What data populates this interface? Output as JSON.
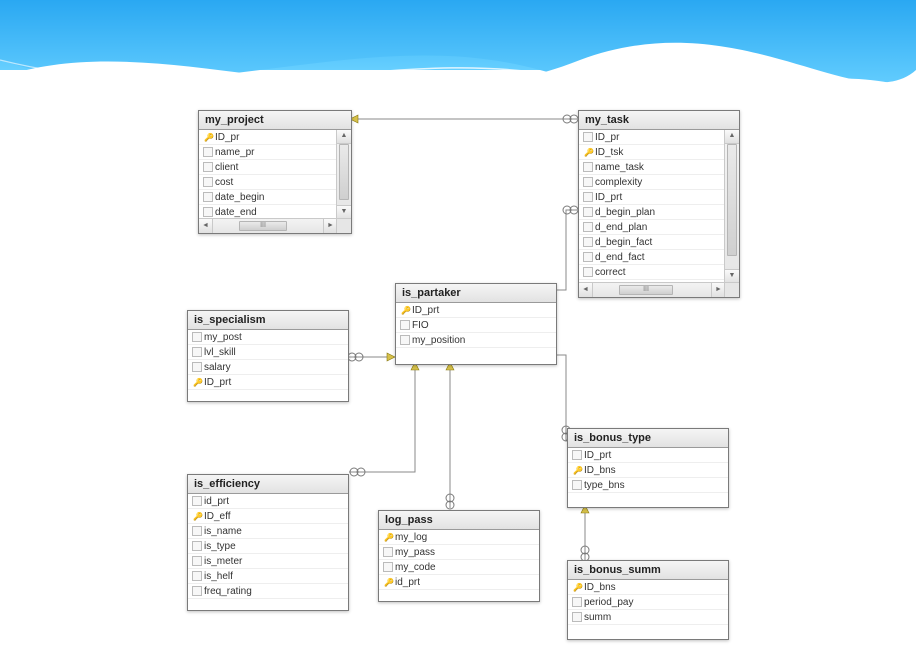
{
  "tables": {
    "my_project": {
      "title": "my_project",
      "columns": [
        {
          "name": "ID_pr",
          "pk": true
        },
        {
          "name": "name_pr",
          "pk": false
        },
        {
          "name": "client",
          "pk": false
        },
        {
          "name": "cost",
          "pk": false
        },
        {
          "name": "date_begin",
          "pk": false
        },
        {
          "name": "date_end",
          "pk": false
        }
      ]
    },
    "my_task": {
      "title": "my_task",
      "columns": [
        {
          "name": "ID_pr",
          "pk": false
        },
        {
          "name": "ID_tsk",
          "pk": true
        },
        {
          "name": "name_task",
          "pk": false
        },
        {
          "name": "complexity",
          "pk": false
        },
        {
          "name": "ID_prt",
          "pk": false
        },
        {
          "name": "d_begin_plan",
          "pk": false
        },
        {
          "name": "d_end_plan",
          "pk": false
        },
        {
          "name": "d_begin_fact",
          "pk": false
        },
        {
          "name": "d_end_fact",
          "pk": false
        },
        {
          "name": "correct",
          "pk": false
        }
      ]
    },
    "is_partaker": {
      "title": "is_partaker",
      "columns": [
        {
          "name": "ID_prt",
          "pk": true
        },
        {
          "name": "FIO",
          "pk": false
        },
        {
          "name": "my_position",
          "pk": false
        }
      ]
    },
    "is_specialism": {
      "title": "is_specialism",
      "columns": [
        {
          "name": "my_post",
          "pk": false
        },
        {
          "name": "lvl_skill",
          "pk": false
        },
        {
          "name": "salary",
          "pk": false
        },
        {
          "name": "ID_prt",
          "pk": true
        }
      ]
    },
    "is_efficiency": {
      "title": "is_efficiency",
      "columns": [
        {
          "name": "id_prt",
          "pk": false
        },
        {
          "name": "ID_eff",
          "pk": true
        },
        {
          "name": "is_name",
          "pk": false
        },
        {
          "name": "is_type",
          "pk": false
        },
        {
          "name": "is_meter",
          "pk": false
        },
        {
          "name": "is_helf",
          "pk": false
        },
        {
          "name": "freq_rating",
          "pk": false
        }
      ]
    },
    "log_pass": {
      "title": "log_pass",
      "columns": [
        {
          "name": "my_log",
          "pk": true
        },
        {
          "name": "my_pass",
          "pk": false
        },
        {
          "name": "my_code",
          "pk": false
        },
        {
          "name": "id_prt",
          "pk": true
        }
      ]
    },
    "is_bonus_type": {
      "title": "is_bonus_type",
      "columns": [
        {
          "name": "ID_prt",
          "pk": false
        },
        {
          "name": "ID_bns",
          "pk": true
        },
        {
          "name": "type_bns",
          "pk": false
        }
      ]
    },
    "is_bonus_summ": {
      "title": "is_bonus_summ",
      "columns": [
        {
          "name": "ID_bns",
          "pk": true
        },
        {
          "name": "period_pay",
          "pk": false
        },
        {
          "name": "summ",
          "pk": false
        }
      ]
    }
  },
  "hscroll_label": "III",
  "scroll_arrows": {
    "up": "▲",
    "down": "▼",
    "left": "◄",
    "right": "►"
  },
  "relationships": [
    {
      "from_table": "my_project",
      "from_col": "ID_pr",
      "from_card": "1",
      "to_table": "my_task",
      "to_col": "ID_pr",
      "to_card": "∞"
    },
    {
      "from_table": "is_partaker",
      "from_col": "ID_prt",
      "from_card": "1",
      "to_table": "my_task",
      "to_col": "ID_prt",
      "to_card": "∞"
    },
    {
      "from_table": "is_partaker",
      "from_col": "ID_prt",
      "from_card": "1",
      "to_table": "is_specialism",
      "to_col": "ID_prt",
      "to_card": "∞"
    },
    {
      "from_table": "is_partaker",
      "from_col": "ID_prt",
      "from_card": "1",
      "to_table": "is_efficiency",
      "to_col": "id_prt",
      "to_card": "∞"
    },
    {
      "from_table": "is_partaker",
      "from_col": "ID_prt",
      "from_card": "1",
      "to_table": "log_pass",
      "to_col": "id_prt",
      "to_card": "∞"
    },
    {
      "from_table": "is_partaker",
      "from_col": "ID_prt",
      "from_card": "1",
      "to_table": "is_bonus_type",
      "to_col": "ID_prt",
      "to_card": "∞"
    },
    {
      "from_table": "is_bonus_type",
      "from_col": "ID_bns",
      "from_card": "1",
      "to_table": "is_bonus_summ",
      "to_col": "ID_bns",
      "to_card": "∞"
    }
  ],
  "chart_data": {
    "type": "table",
    "title": "Entity-Relationship Diagram",
    "entities": [
      "my_project",
      "my_task",
      "is_partaker",
      "is_specialism",
      "is_efficiency",
      "log_pass",
      "is_bonus_type",
      "is_bonus_summ"
    ],
    "relationships": [
      [
        "my_project",
        "1",
        "∞",
        "my_task"
      ],
      [
        "is_partaker",
        "1",
        "∞",
        "my_task"
      ],
      [
        "is_partaker",
        "1",
        "∞",
        "is_specialism"
      ],
      [
        "is_partaker",
        "1",
        "∞",
        "is_efficiency"
      ],
      [
        "is_partaker",
        "1",
        "∞",
        "log_pass"
      ],
      [
        "is_partaker",
        "1",
        "∞",
        "is_bonus_type"
      ],
      [
        "is_bonus_type",
        "1",
        "∞",
        "is_bonus_summ"
      ]
    ]
  }
}
